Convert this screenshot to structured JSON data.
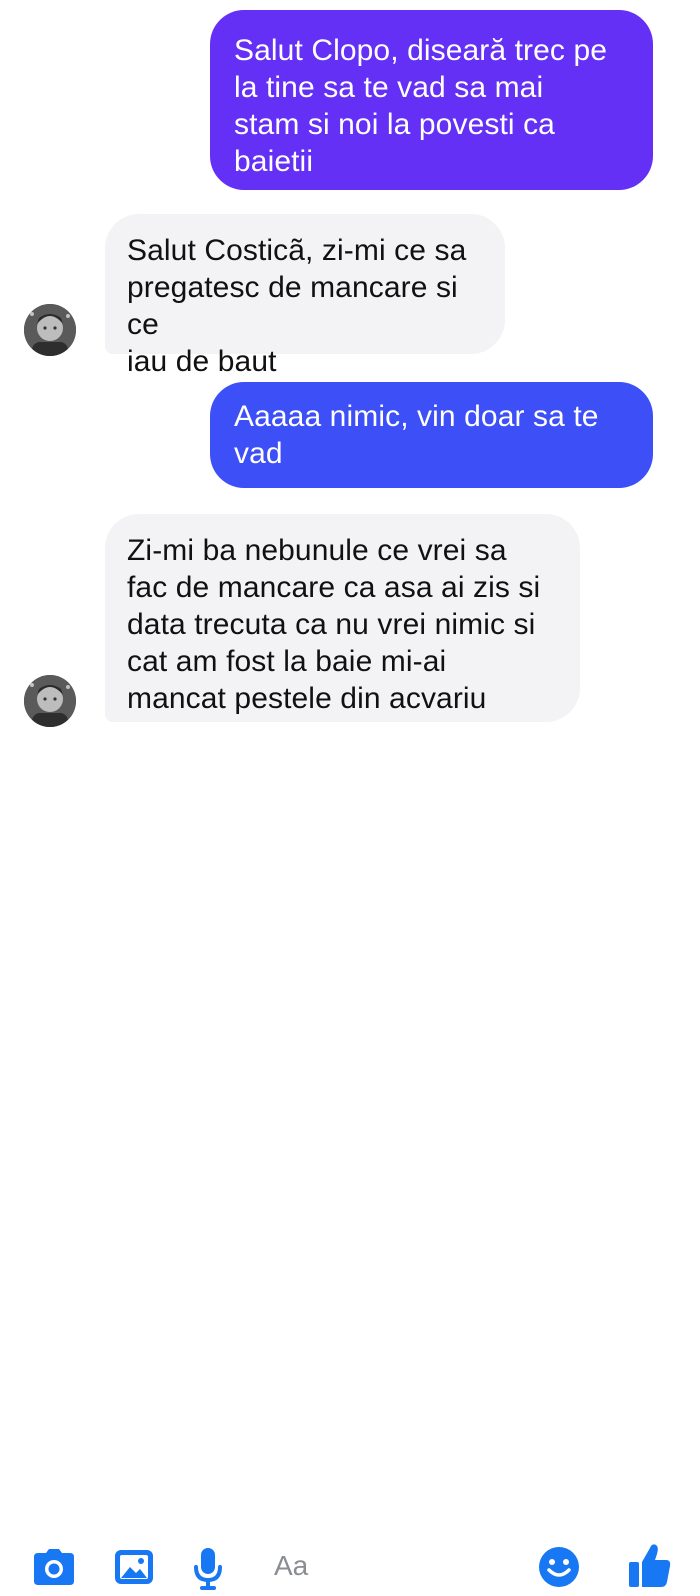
{
  "messages": [
    {
      "text": "Salut Clopo, diseară trec pe\nla tine sa te vad sa mai\nstam si noi la povesti ca\nbaietii",
      "direction": "outgoing"
    },
    {
      "text": "Salut Costicã, zi-mi ce sa\npregatesc de mancare si ce\niau de baut",
      "direction": "incoming"
    },
    {
      "text": "Aaaaa nimic, vin doar sa te\nvad",
      "direction": "outgoing"
    },
    {
      "text": "Zi-mi ba nebunule ce vrei sa\nfac de mancare ca asa ai zis si\ndata trecuta ca nu vrei nimic si\ncat am fost la baie mi-ai\nmancat pestele din acvariu",
      "direction": "incoming"
    }
  ],
  "composer": {
    "placeholder": "Aa",
    "icons": [
      "camera-icon",
      "gallery-icon",
      "microphone-icon",
      "emoji-icon",
      "like-icon"
    ]
  },
  "colors": {
    "outgoing_1": "#6530f6",
    "outgoing_2": "#3d4ff7",
    "incoming": "#f3f3f5",
    "accent": "#1877f2"
  }
}
